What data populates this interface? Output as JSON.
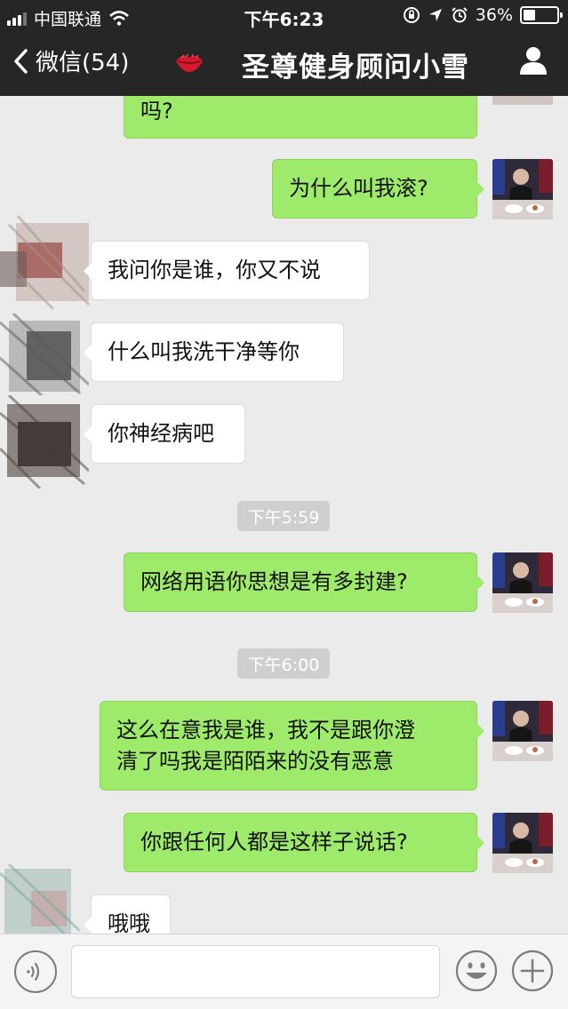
{
  "status_bar": {
    "carrier": "中国联通",
    "time": "下午6:23",
    "battery_text": "36%",
    "battery_level": 0.36
  },
  "nav": {
    "back_label": "微信(54)",
    "title": "圣尊健身顾问小雪"
  },
  "messages": [
    {
      "side": "right",
      "text": "吗?"
    },
    {
      "side": "right",
      "text": "为什么叫我滚?"
    },
    {
      "side": "left",
      "text": "我问你是谁，你又不说"
    },
    {
      "side": "left",
      "text": "什么叫我洗干净等你"
    },
    {
      "side": "left",
      "text": "你神经病吧"
    },
    {
      "type": "time",
      "text": "下午5:59"
    },
    {
      "side": "right",
      "text": "网络用语你思想是有多封建?"
    },
    {
      "type": "time",
      "text": "下午6:00"
    },
    {
      "side": "right",
      "lines": [
        "这么在意我是谁，我不是跟你澄",
        "清了吗我是陌陌来的没有恶意"
      ]
    },
    {
      "side": "right",
      "text": "你跟任何人都是这样子说话?"
    },
    {
      "side": "left",
      "text": "哦哦"
    }
  ],
  "input": {
    "placeholder": ""
  },
  "icons": {
    "back": "chevron-left-icon",
    "title_decoration": "lips-icon",
    "profile": "person-icon",
    "voice": "voice-icon",
    "emoji": "emoji-icon",
    "more": "plus-icon"
  },
  "colors": {
    "nav_bg": "#262626",
    "chat_bg": "#ebebeb",
    "bubble_sent": "#9eea6a",
    "bubble_received": "#ffffff"
  }
}
